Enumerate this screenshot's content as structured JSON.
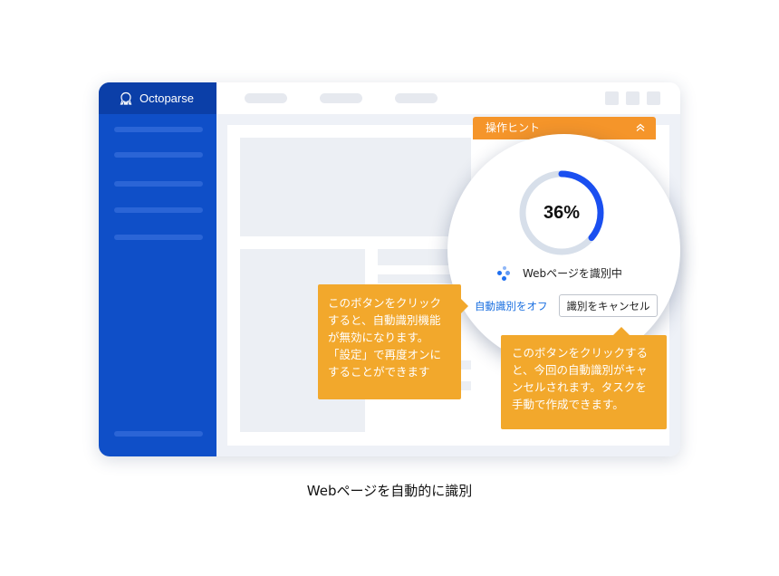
{
  "app": {
    "brand": "Octoparse"
  },
  "hint_panel": {
    "title": "操作ヒント"
  },
  "recognition": {
    "progress_label": "36%",
    "progress": 0.36,
    "status": "Webページを識別中",
    "auto_off_link": "自動識別をオフ",
    "cancel_button": "識別をキャンセル"
  },
  "tooltips": {
    "auto_off": [
      "このボタンをクリック",
      "すると、自動識別機能",
      "が無効になります。",
      "「設定」で再度オンに",
      "することができます"
    ],
    "cancel": [
      "このボタンをクリックする",
      "と、今回の自動識別がキャ",
      "ンセルされます。タスクを",
      "手動で作成できます。"
    ]
  },
  "caption": "Webページを自動的に識別",
  "colors": {
    "sidebar": "#0f4fc8",
    "accent_orange": "#f5952a",
    "tooltip": "#f2a82c",
    "progress": "#1a4ff0",
    "link": "#1a6fe0"
  }
}
